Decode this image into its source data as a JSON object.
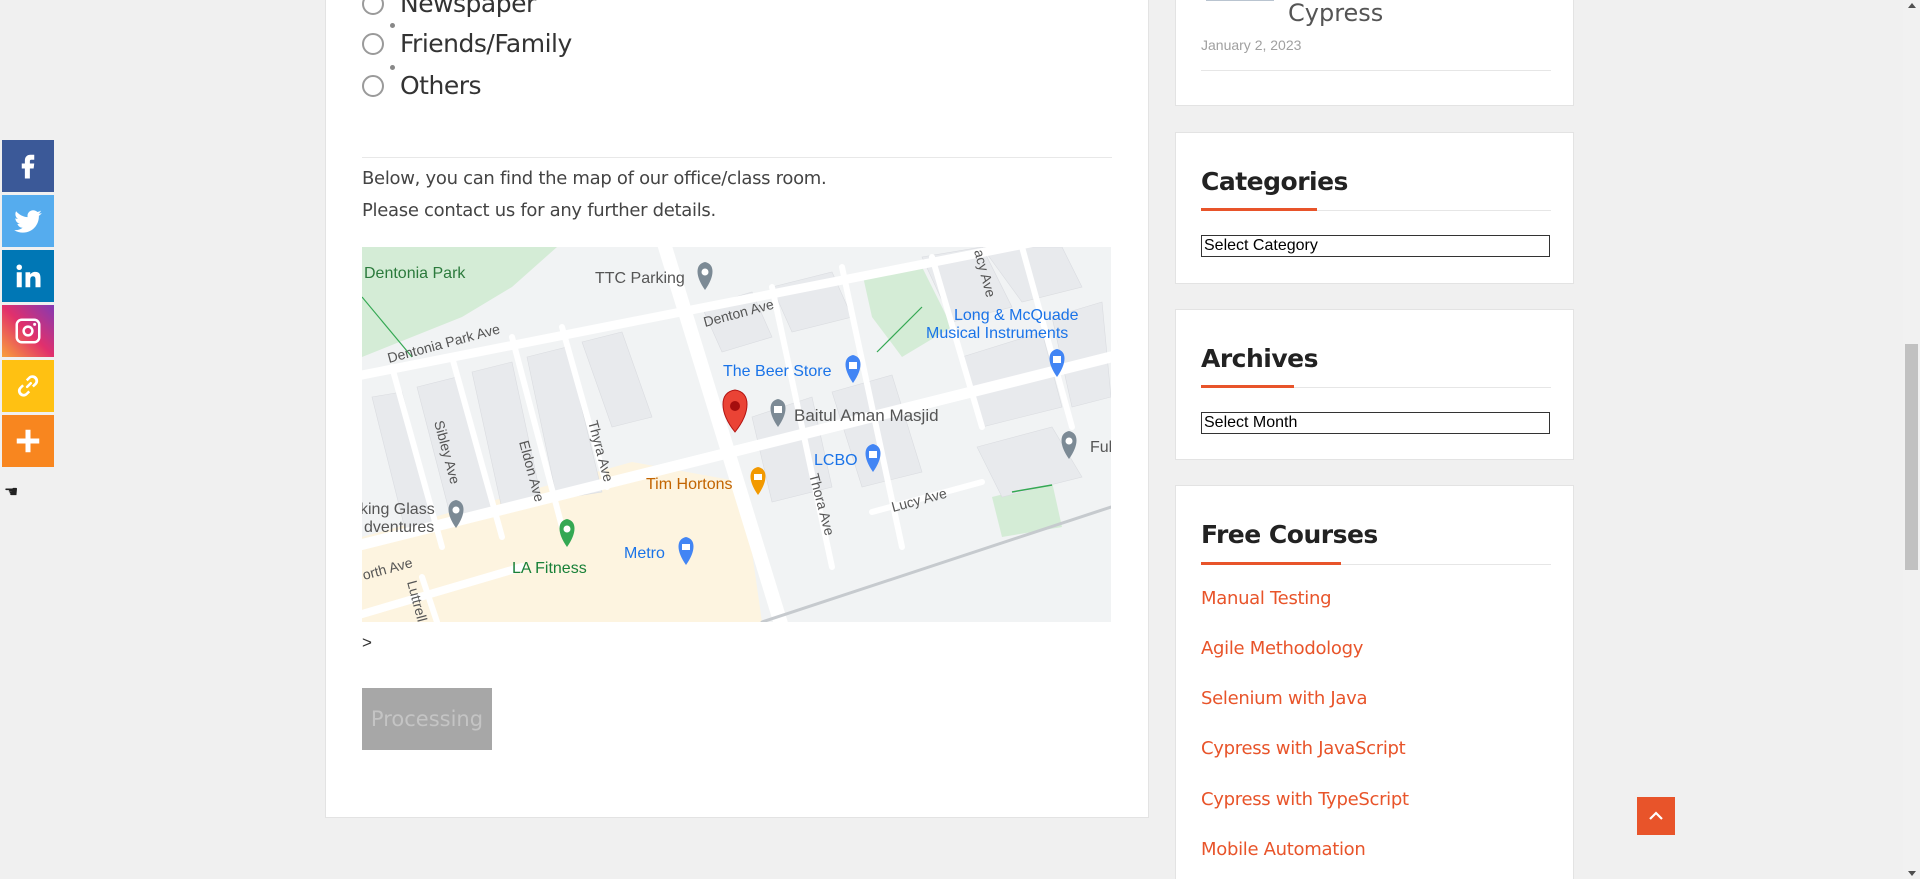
{
  "share": {
    "items": [
      {
        "name": "facebook",
        "color": "#3b5998",
        "icon": "facebook-icon"
      },
      {
        "name": "twitter",
        "color": "#55acee",
        "icon": "twitter-icon"
      },
      {
        "name": "linkedin",
        "color": "#0077b5",
        "icon": "linkedin-icon"
      },
      {
        "name": "instagram",
        "color": "#c13584",
        "icon": "instagram-icon"
      },
      {
        "name": "copy-link",
        "color": "#ffc112",
        "icon": "link-icon"
      },
      {
        "name": "more",
        "color": "#f8861f",
        "icon": "plus-icon"
      }
    ],
    "hide_icon": "hand-icon"
  },
  "form": {
    "options": [
      "Newspaper",
      "Friends/Family",
      "Others"
    ],
    "intro_line1": "Below, you can find the map of our office/class room.",
    "intro_line2": "Please contact us for any further details.",
    "gt": ">",
    "submit_label": "Processing"
  },
  "map": {
    "labels": {
      "dentonia_park": "Dentonia Park",
      "ttc_parking": "TTC Parking",
      "denton_ave": "Denton Ave",
      "dentonia_park_ave": "Dentonia Park Ave",
      "nancy_ave": "acy Ave",
      "long_mcquade_1": "Long & McQuade",
      "long_mcquade_2": "Musical Instruments",
      "beer_store": "The Beer Store",
      "masjid": "Baitul Aman Masjid",
      "sibley": "Sibley Ave",
      "eldon": "Eldon Ave",
      "thyra": "Thyra Ave",
      "lcbo": "LCBO",
      "ful": "Ful",
      "tim_hortons": "Tim Hortons",
      "thora": "Thora Ave",
      "lucy": "Lucy Ave",
      "looking_glass_1": "king Glass",
      "looking_glass_2": "dventures",
      "la_fitness": "LA Fitness",
      "metro": "Metro",
      "north_ave": "orth Ave",
      "luttrell": "Luttrell"
    },
    "colors": {
      "pin": "#ea4335",
      "blue_poi": "#4285f4",
      "green_poi": "#34a853",
      "orange_poi": "#f29900",
      "gray_poi": "#7c8a95",
      "park": "#d4ecd6",
      "commercial": "#fdf4e0",
      "road": "#ffffff",
      "block": "#e8eaed"
    }
  },
  "sidebar": {
    "recent_title": "Cypress",
    "recent_date": "January 2, 2023",
    "categories_title": "Categories",
    "categories_select": "Select Category",
    "archives_title": "Archives",
    "archives_select": "Select Month",
    "courses_title": "Free Courses",
    "courses": [
      "Manual Testing",
      "Agile Methodology",
      "Selenium with Java",
      "Cypress with JavaScript",
      "Cypress with TypeScript",
      "Mobile Automation"
    ]
  },
  "accent_color": "#e8542a"
}
